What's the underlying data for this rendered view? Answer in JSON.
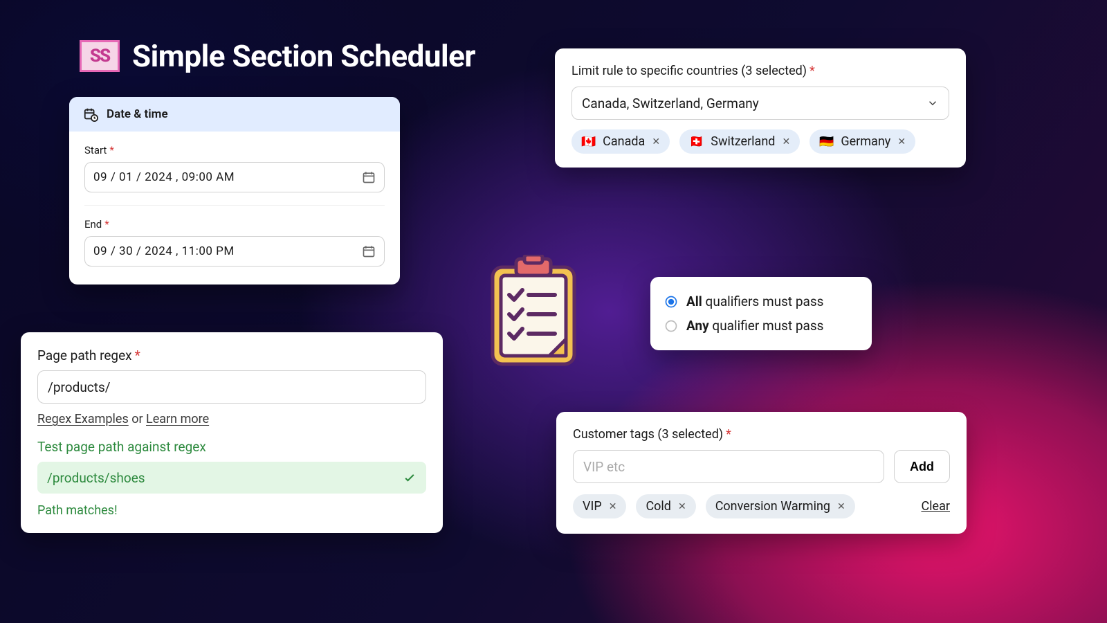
{
  "app": {
    "logo_text": "SS",
    "title": "Simple Section Scheduler"
  },
  "datetime": {
    "header": "Date & time",
    "start_label": "Start",
    "end_label": "End",
    "start_value": "09 / 01 / 2024 , 09:00 AM",
    "end_value": "09 / 30 / 2024 , 11:00 PM"
  },
  "regex": {
    "label": "Page path regex",
    "value": "/products/",
    "examples_link": "Regex Examples",
    "or_text": " or ",
    "learn_more_link": "Learn more",
    "test_label": "Test page path against regex",
    "test_value": "/products/shoes",
    "result": "Path matches!"
  },
  "countries": {
    "label": "Limit rule to specific countries (3 selected)",
    "dropdown_text": "Canada, Switzerland, Germany",
    "items": [
      {
        "flag": "🇨🇦",
        "name": "Canada"
      },
      {
        "flag": "🇨🇭",
        "name": "Switzerland"
      },
      {
        "flag": "🇩🇪",
        "name": "Germany"
      }
    ]
  },
  "qualifiers": {
    "all_bold": "All",
    "all_rest": " qualifiers must pass",
    "any_bold": "Any",
    "any_rest": " qualifier must pass",
    "selected": "all"
  },
  "tags": {
    "label": "Customer tags (3 selected)",
    "placeholder": "VIP etc",
    "add_label": "Add",
    "clear_label": "Clear",
    "items": [
      "VIP",
      "Cold",
      "Conversion Warming"
    ]
  }
}
